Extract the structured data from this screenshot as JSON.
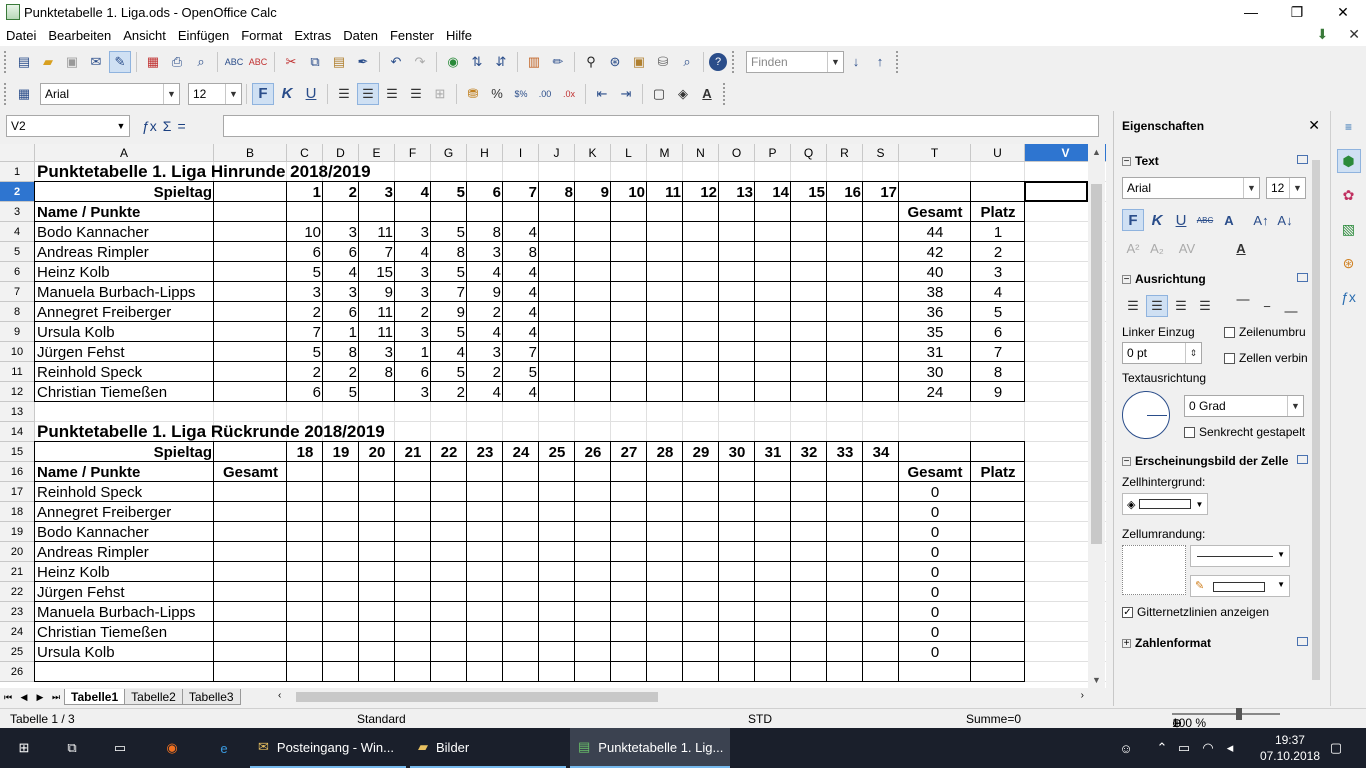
{
  "window": {
    "title": "Punktetabelle 1. Liga.ods - OpenOffice Calc",
    "minimize": "—",
    "restore": "❐",
    "close": "✕",
    "doc_close": "✕"
  },
  "menu": [
    "Datei",
    "Bearbeiten",
    "Ansicht",
    "Einfügen",
    "Format",
    "Extras",
    "Daten",
    "Fenster",
    "Hilfe"
  ],
  "toolbar": {
    "find_placeholder": "Finden"
  },
  "format": {
    "font": "Arial",
    "size": "12"
  },
  "formula": {
    "cellref": "V2",
    "content": ""
  },
  "columns": [
    "A",
    "B",
    "C",
    "D",
    "E",
    "F",
    "G",
    "H",
    "I",
    "J",
    "K",
    "L",
    "M",
    "N",
    "O",
    "P",
    "Q",
    "R",
    "S",
    "T",
    "U",
    "V"
  ],
  "rows": [
    "1",
    "2",
    "3",
    "4",
    "5",
    "6",
    "7",
    "8",
    "9",
    "10",
    "11",
    "12",
    "13",
    "14",
    "15",
    "16",
    "17",
    "18",
    "19",
    "20",
    "21",
    "22",
    "23",
    "24",
    "25",
    "26"
  ],
  "hinrunde": {
    "title": "Punktetabelle 1. Liga Hinrunde 2018/2019",
    "spieltag_label": "Spieltag",
    "spieltage": [
      "1",
      "2",
      "3",
      "4",
      "5",
      "6",
      "7",
      "8",
      "9",
      "10",
      "11",
      "12",
      "13",
      "14",
      "15",
      "16",
      "17"
    ],
    "name_label": "Name / Punkte",
    "gesamt_label": "Gesamt",
    "platz_label": "Platz",
    "players": [
      {
        "name": "Bodo Kannacher",
        "points": [
          "10",
          "3",
          "11",
          "3",
          "5",
          "8",
          "4"
        ],
        "gesamt": "44",
        "platz": "1"
      },
      {
        "name": "Andreas Rimpler",
        "points": [
          "6",
          "6",
          "7",
          "4",
          "8",
          "3",
          "8"
        ],
        "gesamt": "42",
        "platz": "2"
      },
      {
        "name": "Heinz Kolb",
        "points": [
          "5",
          "4",
          "15",
          "3",
          "5",
          "4",
          "4"
        ],
        "gesamt": "40",
        "platz": "3"
      },
      {
        "name": "Manuela Burbach-Lipps",
        "points": [
          "3",
          "3",
          "9",
          "3",
          "7",
          "9",
          "4"
        ],
        "gesamt": "38",
        "platz": "4"
      },
      {
        "name": "Annegret Freiberger",
        "points": [
          "2",
          "6",
          "11",
          "2",
          "9",
          "2",
          "4"
        ],
        "gesamt": "36",
        "platz": "5"
      },
      {
        "name": "Ursula Kolb",
        "points": [
          "7",
          "1",
          "11",
          "3",
          "5",
          "4",
          "4"
        ],
        "gesamt": "35",
        "platz": "6"
      },
      {
        "name": "Jürgen Fehst",
        "points": [
          "5",
          "8",
          "3",
          "1",
          "4",
          "3",
          "7"
        ],
        "gesamt": "31",
        "platz": "7"
      },
      {
        "name": "Reinhold Speck",
        "points": [
          "2",
          "2",
          "8",
          "6",
          "5",
          "2",
          "5"
        ],
        "gesamt": "30",
        "platz": "8"
      },
      {
        "name": "Christian Tiemeßen",
        "points": [
          "6",
          "5",
          "",
          "3",
          "2",
          "4",
          "4"
        ],
        "gesamt": "24",
        "platz": "9"
      }
    ]
  },
  "rueckrunde": {
    "title": "Punktetabelle 1. Liga Rückrunde 2018/2019",
    "spieltag_label": "Spieltag",
    "spieltage": [
      "18",
      "19",
      "20",
      "21",
      "22",
      "23",
      "24",
      "25",
      "26",
      "27",
      "28",
      "29",
      "30",
      "31",
      "32",
      "33",
      "34"
    ],
    "name_label": "Name / Punkte",
    "gesamt_b_label": "Gesamt",
    "gesamt_label": "Gesamt",
    "platz_label": "Platz",
    "players": [
      {
        "name": "Reinhold Speck",
        "gesamt": "0"
      },
      {
        "name": "Annegret Freiberger",
        "gesamt": "0"
      },
      {
        "name": "Bodo Kannacher",
        "gesamt": "0"
      },
      {
        "name": "Andreas Rimpler",
        "gesamt": "0"
      },
      {
        "name": "Heinz Kolb",
        "gesamt": "0"
      },
      {
        "name": "Jürgen Fehst",
        "gesamt": "0"
      },
      {
        "name": "Manuela Burbach-Lipps",
        "gesamt": "0"
      },
      {
        "name": "Christian Tiemeßen",
        "gesamt": "0"
      },
      {
        "name": "Ursula Kolb",
        "gesamt": "0"
      }
    ]
  },
  "tabs": [
    "Tabelle1",
    "Tabelle2",
    "Tabelle3"
  ],
  "status": {
    "sheet": "Tabelle 1 / 3",
    "style": "Standard",
    "mode": "STD",
    "sum": "Summe=0",
    "zoom": "100 %"
  },
  "sidebar": {
    "title": "Eigenschaften",
    "text_section": "Text",
    "font": "Arial",
    "size": "12",
    "align_section": "Ausrichtung",
    "indent_label": "Linker Einzug",
    "indent_value": "0 pt",
    "wrap_label": "Zeilenumbru",
    "merge_label": "Zellen verbin",
    "textdir_label": "Textausrichtung",
    "angle_value": "0 Grad",
    "stacked_label": "Senkrecht gestapelt",
    "appearance_section": "Erscheinungsbild der Zelle",
    "bg_label": "Zellhintergrund:",
    "border_label": "Zellumrandung:",
    "gridlines_label": "Gitternetzlinien anzeigen",
    "numformat_section": "Zahlenformat"
  },
  "taskbar": {
    "tasks": [
      {
        "label": "Posteingang - Win..."
      },
      {
        "label": "Bilder"
      },
      {
        "label": "Punktetabelle 1. Lig..."
      }
    ],
    "time": "19:37",
    "date": "07.10.2018"
  },
  "colors": {
    "selection": "#2e75d0",
    "taskbar": "#1a1f2b"
  }
}
